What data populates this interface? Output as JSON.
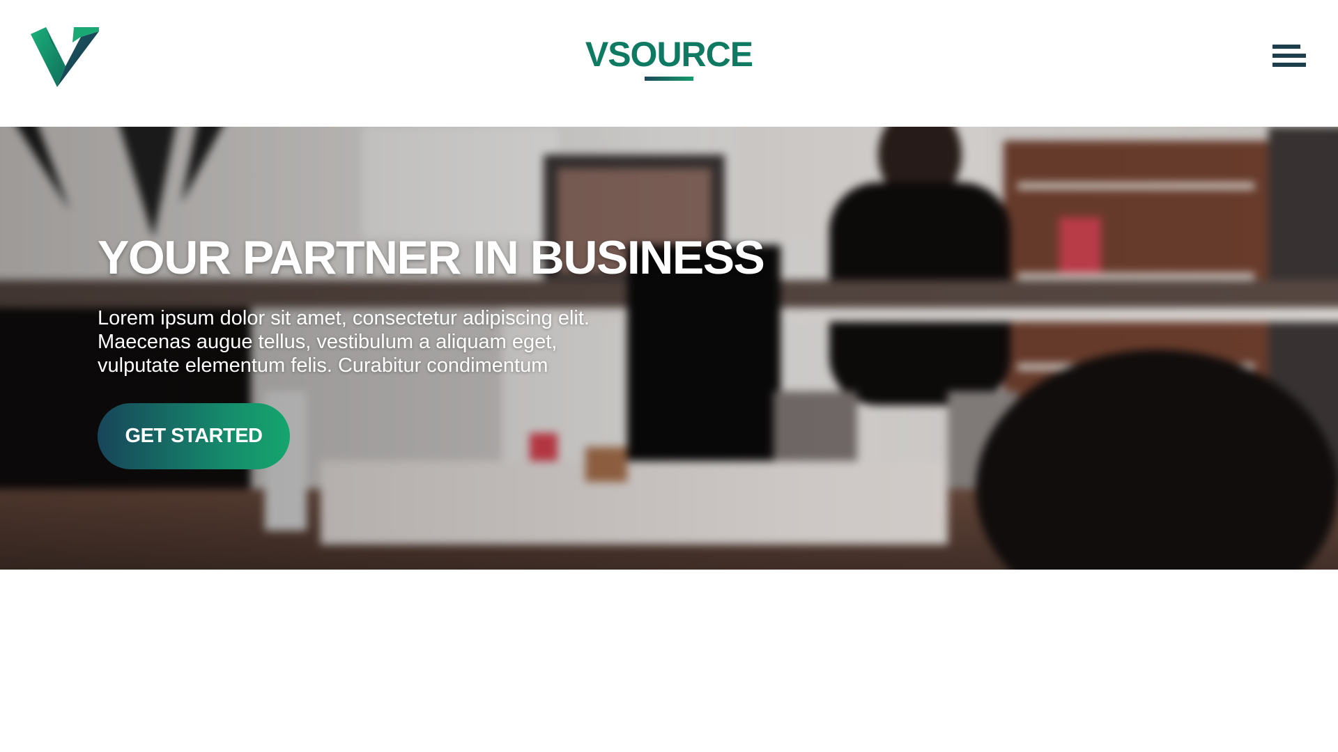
{
  "header": {
    "brand_name": "VSOURCE",
    "menu_icon": "hamburger-menu-icon",
    "logo_icon": "v-logo-icon"
  },
  "hero": {
    "title": "YOUR PARTNER IN BUSINESS",
    "text_lines": [
      "Lorem ipsum dolor sit amet, consectetur adipiscing elit.",
      "Maecenas augue tellus, vestibulum a aliquam eget,",
      "vulputate elementum felis. Curabitur condimentum"
    ],
    "cta_label": "GET STARTED"
  },
  "colors": {
    "brand_green": "#0e7a62",
    "brand_dark": "#1d3e4a",
    "cta_gradient_start": "#17455a",
    "cta_gradient_end": "#15a56e"
  }
}
